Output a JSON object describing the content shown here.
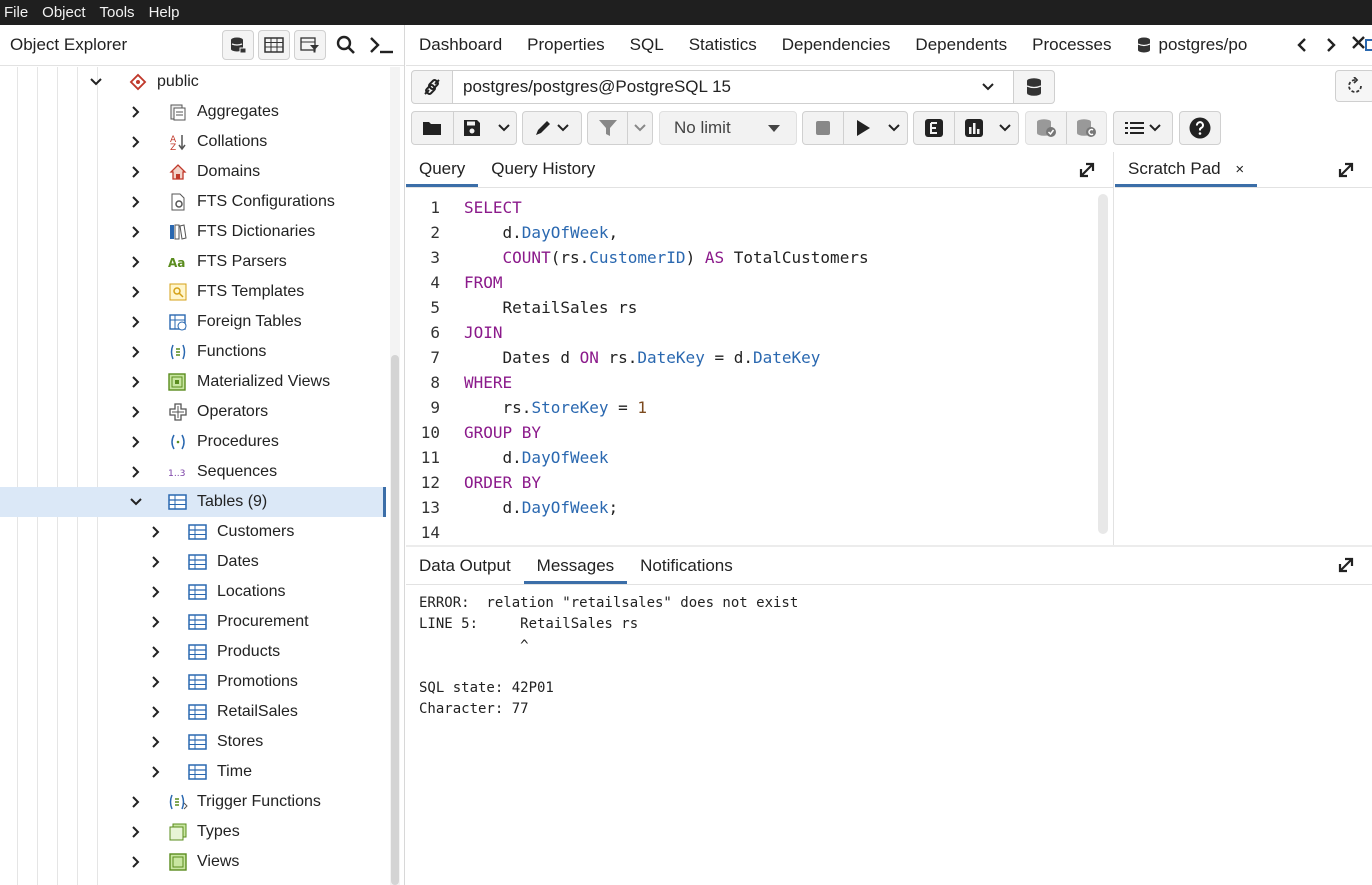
{
  "menu": [
    "File",
    "Object",
    "Tools",
    "Help"
  ],
  "explorer": {
    "title": "Object Explorer",
    "tree": [
      {
        "label": "public",
        "icon": "schema-icon",
        "expanded": true
      },
      {
        "label": "Aggregates",
        "icon": "aggregates-icon"
      },
      {
        "label": "Collations",
        "icon": "collations-icon"
      },
      {
        "label": "Domains",
        "icon": "domains-icon"
      },
      {
        "label": "FTS Configurations",
        "icon": "fts-configurations-icon"
      },
      {
        "label": "FTS Dictionaries",
        "icon": "fts-dictionaries-icon"
      },
      {
        "label": "FTS Parsers",
        "icon": "fts-parsers-icon"
      },
      {
        "label": "FTS Templates",
        "icon": "fts-templates-icon"
      },
      {
        "label": "Foreign Tables",
        "icon": "foreign-tables-icon"
      },
      {
        "label": "Functions",
        "icon": "functions-icon"
      },
      {
        "label": "Materialized Views",
        "icon": "materialized-views-icon"
      },
      {
        "label": "Operators",
        "icon": "operators-icon"
      },
      {
        "label": "Procedures",
        "icon": "procedures-icon"
      },
      {
        "label": "Sequences",
        "icon": "sequences-icon"
      },
      {
        "label": "Tables (9)",
        "icon": "tables-icon",
        "expanded": true,
        "selected": true
      },
      {
        "label": "Customers",
        "icon": "table-icon"
      },
      {
        "label": "Dates",
        "icon": "table-icon"
      },
      {
        "label": "Locations",
        "icon": "table-icon"
      },
      {
        "label": "Procurement",
        "icon": "table-icon"
      },
      {
        "label": "Products",
        "icon": "table-icon"
      },
      {
        "label": "Promotions",
        "icon": "table-icon"
      },
      {
        "label": "RetailSales",
        "icon": "table-icon"
      },
      {
        "label": "Stores",
        "icon": "table-icon"
      },
      {
        "label": "Time",
        "icon": "table-icon"
      },
      {
        "label": "Trigger Functions",
        "icon": "trigger-functions-icon"
      },
      {
        "label": "Types",
        "icon": "types-icon"
      },
      {
        "label": "Views",
        "icon": "views-icon"
      }
    ]
  },
  "tabs": [
    "Dashboard",
    "Properties",
    "SQL",
    "Statistics",
    "Dependencies",
    "Dependents",
    "Processes"
  ],
  "active_tab": "postgres/po",
  "connection": "postgres/postgres@PostgreSQL 15",
  "limit": "No limit",
  "query_tabs": [
    "Query",
    "Query History"
  ],
  "scratch_pad": "Scratch Pad",
  "scratch_close": "×",
  "code_lines": [
    "1",
    "2",
    "3",
    "4",
    "5",
    "6",
    "7",
    "8",
    "9",
    "10",
    "11",
    "12",
    "13",
    "14"
  ],
  "output_tabs": [
    "Data Output",
    "Messages",
    "Notifications"
  ],
  "messages": [
    "ERROR:  relation \"retailsales\" does not exist",
    "LINE 5:     RetailSales rs",
    "            ^",
    "",
    "SQL state: 42P01",
    "Character: 77"
  ],
  "colors": {
    "accent": "#3b6ea8",
    "keyword": "#8b1a8b",
    "identifier": "#2a68b0",
    "number": "#7c4a1e",
    "selected_bg": "#dbe8f7",
    "menubar_bg": "#1f1f1f"
  }
}
